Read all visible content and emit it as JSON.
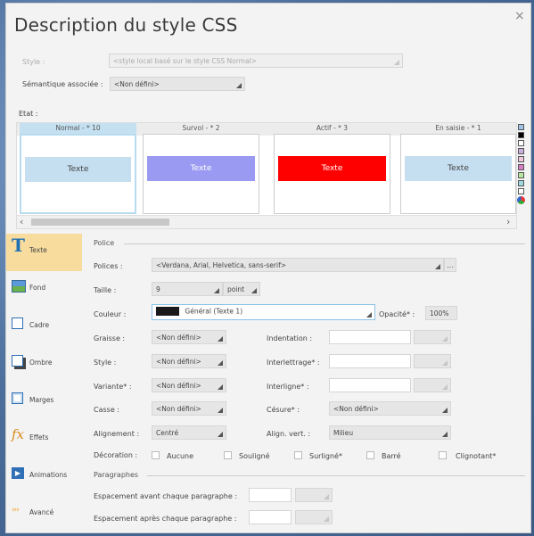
{
  "dialog": {
    "title": "Description du style CSS",
    "close": "×"
  },
  "style_row": {
    "label": "Style :",
    "value": "<style local basé sur le style CSS Normal>"
  },
  "semantic_row": {
    "label": "Sémantique associée :",
    "value": "<Non défini>"
  },
  "etat": {
    "label": "Etat :",
    "states": [
      {
        "tab": "Normal - * 10",
        "sample": "Texte",
        "bg": "#c5def0",
        "color": "#444444"
      },
      {
        "tab": "Survol - * 2",
        "sample": "Texte",
        "bg": "#9a9af2",
        "color": "#ffffff"
      },
      {
        "tab": "Actif - * 3",
        "sample": "Texte",
        "bg": "#ff0000",
        "color": "#ffffff"
      },
      {
        "tab": "En saisie - * 1",
        "sample": "Texte",
        "bg": "#c5def0",
        "color": "#444444"
      }
    ],
    "scroll_left": "‹",
    "scroll_right": "›",
    "color_squares": [
      "#9fc3e7",
      "#000000",
      "#ffffff",
      "#c9b0e0",
      "#f0c8dc",
      "#d77ec6",
      "#b7e6a0",
      "#9ed7e0",
      "#ffffff"
    ]
  },
  "nav": [
    {
      "label": "Texte",
      "icon": "T",
      "icon_color": "#1f6fb5"
    },
    {
      "label": "Fond",
      "icon": "▰",
      "icon_color": "#4a9c3a"
    },
    {
      "label": "Cadre",
      "icon": "",
      "icon_color": "#2f6fb5"
    },
    {
      "label": "Ombre",
      "icon": "",
      "icon_color": "#2f6fb5"
    },
    {
      "label": "Marges",
      "icon": "",
      "icon_color": "#2f6fb5"
    },
    {
      "label": "Effets",
      "icon": "fx",
      "icon_color": "#d98a1c"
    },
    {
      "label": "Animations",
      "icon": "▶",
      "icon_color": "#2f6fb5"
    },
    {
      "label": "Avancé",
      "icon": "›››",
      "icon_color": "#f0a020"
    }
  ],
  "police": {
    "section": "Police",
    "polices_label": "Polices :",
    "polices_value": "<Verdana, Arial, Helvetica, sans-serif>",
    "more_button": "...",
    "taille_label": "Taille :",
    "taille_value": "9",
    "taille_unit": "point",
    "couleur_label": "Couleur :",
    "couleur_value": "Général (Texte 1)",
    "couleur_swatch": "#1a1a1a",
    "opacite_label": "Opacité* :",
    "opacite_value": "100%",
    "graisse_label": "Graisse :",
    "graisse_value": "<Non défini>",
    "indentation_label": "Indentation :",
    "style_label": "Style :",
    "style_value": "<Non défini>",
    "interlettrage_label": "Interlettrage* :",
    "variante_label": "Variante* :",
    "variante_value": "<Non défini>",
    "interligne_label": "Interligne* :",
    "casse_label": "Casse :",
    "casse_value": "<Non défini>",
    "cesure_label": "Césure* :",
    "cesure_value": "<Non défini>",
    "alignement_label": "Alignement :",
    "alignement_value": "Centré",
    "align_vert_label": "Align. vert. :",
    "align_vert_value": "Milieu",
    "decoration_label": "Décoration :",
    "decorations": [
      "Aucune",
      "Souligné",
      "Surligné*",
      "Barré",
      "Clignotant*"
    ]
  },
  "paragraphes": {
    "section": "Paragraphes",
    "avant_label": "Espacement avant chaque paragraphe :",
    "apres_label": "Espacement après chaque paragraphe :"
  }
}
